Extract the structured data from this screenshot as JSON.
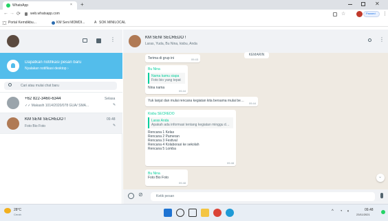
{
  "browser": {
    "tab_title": "WhatsApp",
    "new_tab_glyph": "+",
    "close_glyph": "×",
    "url": "web.whatsapp.com",
    "bookmarks": [
      "Portal Kemdikbu...",
      "KM Seni MDMDI...",
      "SOK MINILOCAL"
    ],
    "profile_label": "Paused"
  },
  "left": {
    "notification": {
      "title": "Dapatkan notifikasi pesan baru",
      "subtitle": "Nyalakan notifikasi desktop ›"
    },
    "search_placeholder": "Cari atau mulai chat baru",
    "chats": [
      {
        "name": "+62 822-3460-6344",
        "preview": "✓✓ Makasih 1014/2020/078 GUA/ SMA...",
        "time": "Selasa",
        "avatar_color": "#9aa4ab"
      },
      {
        "name": "KM SENI SECREDO !",
        "preview": "Foto Bio Foto",
        "time": "09.48",
        "avatar_color": "#b07a55"
      }
    ]
  },
  "right": {
    "header_title": "KM SENI SECREDO !",
    "header_subtitle": "Laras, Yuda, Bu Nina, kisbu, Anda",
    "date_chip": "KEMARIN",
    "messages": [
      {
        "id": "m1",
        "text": "Terima di grup ini",
        "time": "09.43"
      },
      {
        "id": "m2",
        "sender": "Bu Nina",
        "quote_author": "Nama kamu siapa",
        "quote_text": "Foto bio yang tepat",
        "text": "Nina nama",
        "time": "09.44"
      },
      {
        "id": "m3",
        "text": "Yuk lanjut dan mulai rencana kegiatan kita bersama mulai besok",
        "time": "09.44"
      },
      {
        "id": "m4",
        "sender": "Kisbu SECREDO",
        "quote_author": "Laras Anda",
        "quote_text": "Apakah ada informasi tentang kegiatan minggu depan",
        "lines": [
          "Rencana 1 Kelas",
          "Rencana 2 Pameran",
          "Rencana 3 Festival",
          "Rencana 4 Kolaborasi ke sekolah",
          "Rencana 5 Lomba"
        ],
        "time": "09.48"
      },
      {
        "id": "m5",
        "sender": "Bu Nina",
        "text": "Foto Bio Foto",
        "time": "09.48"
      }
    ],
    "composer_placeholder": "Ketik pesan"
  },
  "taskbar": {
    "weather_temp": "28°C",
    "weather_desc": "Cerah",
    "time": "09.48",
    "date": "23/11/2021"
  },
  "colors": {
    "accent": "#00a884",
    "notification": "#53bdeb",
    "chat_bg": "#efeae2",
    "sender_green": "#06cf9c"
  }
}
